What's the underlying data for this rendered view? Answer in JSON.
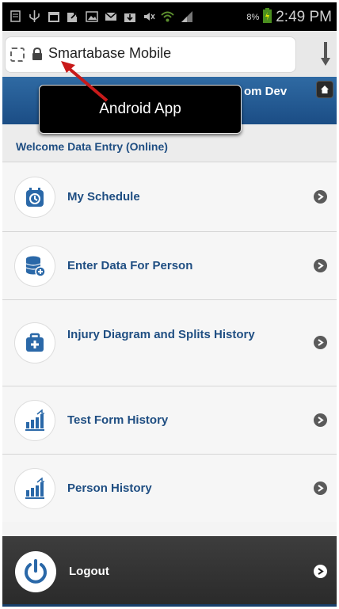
{
  "status_bar": {
    "battery": "8%",
    "time": "2:49 PM"
  },
  "browser": {
    "url_title": "Smartabase Mobile"
  },
  "header": {
    "title_fragment": "om Dev"
  },
  "tooltip": {
    "text": "Android App"
  },
  "welcome": {
    "text": "Welcome Data Entry (Online)"
  },
  "menu": {
    "items": [
      {
        "label": "My Schedule",
        "icon": "schedule-icon"
      },
      {
        "label": "Enter Data For Person",
        "icon": "database-add-icon"
      },
      {
        "label": "Injury Diagram and Splits History",
        "icon": "medical-bag-icon"
      },
      {
        "label": "Test Form History",
        "icon": "bar-chart-icon"
      },
      {
        "label": "Person History",
        "icon": "bar-chart-icon"
      }
    ]
  },
  "footer": {
    "logout_label": "Logout"
  },
  "colors": {
    "accent": "#1f4e82",
    "header": "#2f6aa3",
    "footer": "#333333"
  }
}
